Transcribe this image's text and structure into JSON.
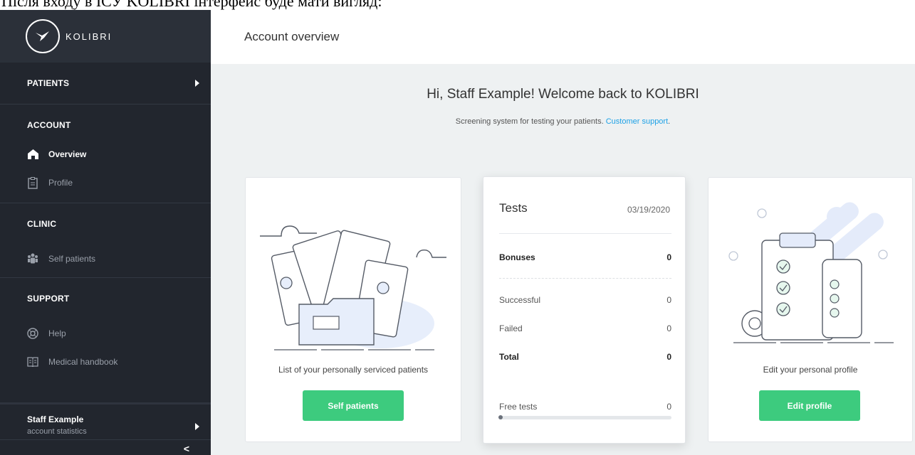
{
  "caption": "Після входу в ІСУ KOLIBRI інтерфейс буде мати вигляд:",
  "brand": {
    "name": "KOLIBRI"
  },
  "sidebar": {
    "patients": "PATIENTS",
    "account": "ACCOUNT",
    "account_items": [
      {
        "label": "Overview",
        "icon": "home-icon",
        "active": true
      },
      {
        "label": "Profile",
        "icon": "clipboard-icon"
      }
    ],
    "clinic": "CLINIC",
    "clinic_items": [
      {
        "label": "Self patients",
        "icon": "users-icon"
      }
    ],
    "support": "SUPPORT",
    "support_items": [
      {
        "label": "Help",
        "icon": "lifebuoy-icon"
      },
      {
        "label": "Medical handbook",
        "icon": "book-icon"
      }
    ],
    "user": {
      "name": "Staff Example",
      "sub": "account statistics"
    },
    "collapse": "<"
  },
  "header": {
    "title": "Account overview"
  },
  "welcome": {
    "title": "Hi, Staff Example! Welcome back to KOLIBRI",
    "subtitle": "Screening system for testing your patients.",
    "support_link": "Customer support",
    "period": "."
  },
  "cards": {
    "patients": {
      "desc": "List of your personally serviced patients",
      "button": "Self patients"
    },
    "tests": {
      "title": "Tests",
      "date": "03/19/2020",
      "bonuses": {
        "label": "Bonuses",
        "value": "0"
      },
      "successful": {
        "label": "Successful",
        "value": "0"
      },
      "failed": {
        "label": "Failed",
        "value": "0"
      },
      "total": {
        "label": "Total",
        "value": "0"
      },
      "free": {
        "label": "Free tests",
        "value": "0",
        "progress": 0
      }
    },
    "profile": {
      "desc": "Edit your personal profile",
      "button": "Edit profile"
    }
  },
  "colors": {
    "accent": "#3dcb7e",
    "link": "#1da1e6",
    "sidebar": "#22262e"
  }
}
